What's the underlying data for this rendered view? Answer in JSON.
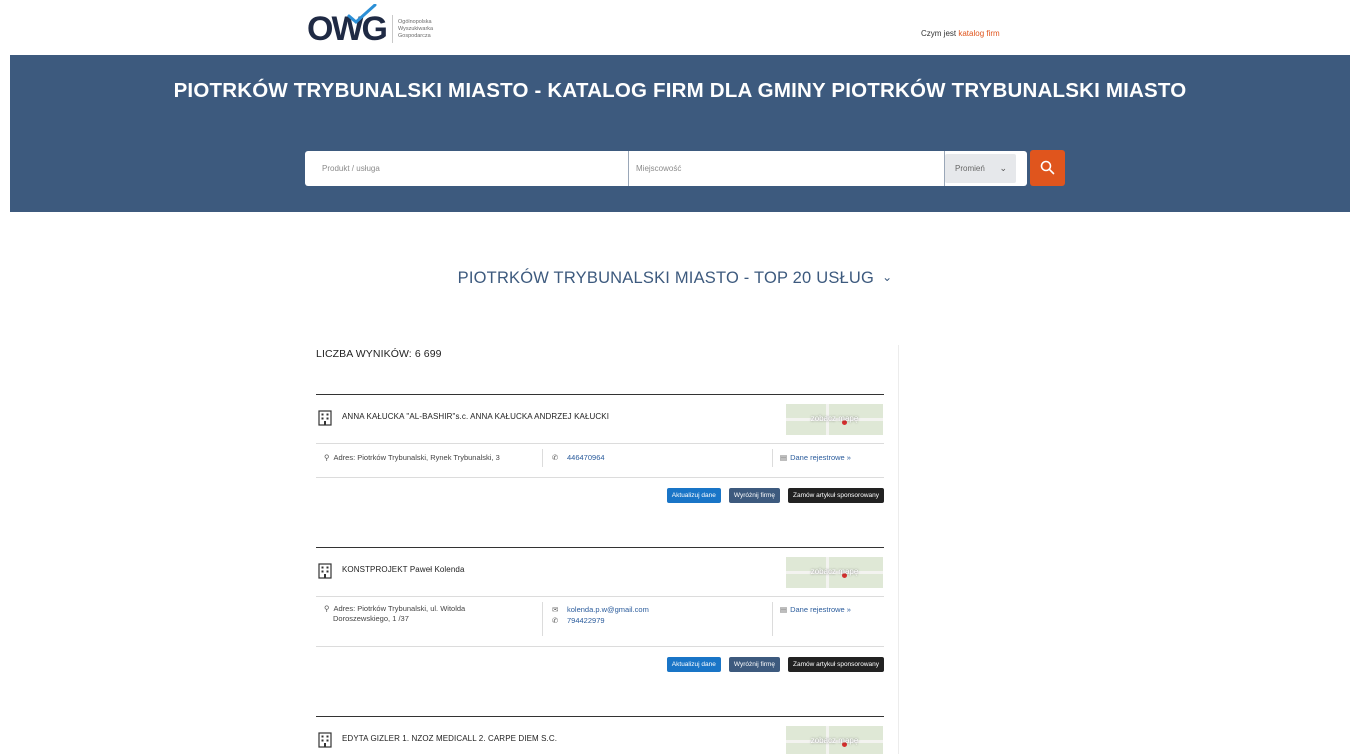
{
  "header": {
    "logo_mark": "OWG",
    "logo_lines": [
      "Ogólnopolska",
      "Wyszukiwarka",
      "Gospodarcza"
    ],
    "link_prefix": "Czym jest ",
    "link_accent": "katalog firm"
  },
  "hero": {
    "title": "PIOTRKÓW TRYBUNALSKI MIASTO - KATALOG FIRM DLA GMINY PIOTRKÓW TRYBUNALSKI MIASTO",
    "product_placeholder": "Produkt / usługa",
    "city_placeholder": "Miejscowość",
    "radius_label": "Promień"
  },
  "top20": {
    "label": "PIOTRKÓW TRYBUNALSKI MIASTO - TOP 20 USŁUG"
  },
  "results": {
    "count_label": "LICZBA WYNIKÓW: 6 699",
    "map_label": "zobacz mapę",
    "registry_label": "Dane rejestrowe »",
    "btn_update": "Aktualizuj dane",
    "btn_feature": "Wyróżnij firmę",
    "btn_article": "Zamów artykuł sponsorowany",
    "items": [
      {
        "name": "ANNA KAŁUCKA \"AL-BASHIR\"s.c. ANNA KAŁUCKA ANDRZEJ KAŁUCKI",
        "address_line1": "Adres: Piotrków Trybunalski, Rynek Trybunalski, 3",
        "address_line2": "",
        "email": "",
        "phone": "446470964"
      },
      {
        "name": "KONSTPROJEKT Paweł Kolenda",
        "address_line1": "Adres: Piotrków Trybunalski, ul. Witolda",
        "address_line2": "Doroszewskiego, 1 /37",
        "email": "kolenda.p.w@gmail.com",
        "phone": "794422979"
      },
      {
        "name": "EDYTA GIZLER 1. NZOZ MEDICALL 2. CARPE DIEM S.C."
      }
    ]
  },
  "colors": {
    "hero_bg": "#3d5a7e",
    "accent": "#e0551d",
    "btn_blue": "#1975c7",
    "btn_slate": "#3d5a7e",
    "btn_dark": "#222222",
    "link": "#2b5c9c"
  }
}
